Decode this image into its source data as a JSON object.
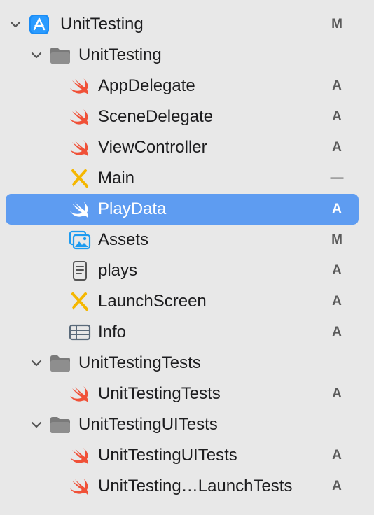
{
  "project": {
    "name": "UnitTesting",
    "status": "M",
    "icon": "app-project-icon",
    "groups": [
      {
        "name": "UnitTesting",
        "icon": "folder-icon",
        "files": [
          {
            "name": "AppDelegate",
            "icon": "swift-file-icon",
            "status": "A"
          },
          {
            "name": "SceneDelegate",
            "icon": "swift-file-icon",
            "status": "A"
          },
          {
            "name": "ViewController",
            "icon": "swift-file-icon",
            "status": "A"
          },
          {
            "name": "Main",
            "icon": "storyboard-icon",
            "status": "—"
          },
          {
            "name": "PlayData",
            "icon": "swift-file-icon",
            "status": "A",
            "selected": true
          },
          {
            "name": "Assets",
            "icon": "asset-catalog-icon",
            "status": "M"
          },
          {
            "name": "plays",
            "icon": "document-icon",
            "status": "A"
          },
          {
            "name": "LaunchScreen",
            "icon": "storyboard-icon",
            "status": "A"
          },
          {
            "name": "Info",
            "icon": "plist-table-icon",
            "status": "A"
          }
        ]
      },
      {
        "name": "UnitTestingTests",
        "icon": "folder-icon",
        "files": [
          {
            "name": "UnitTestingTests",
            "icon": "swift-file-icon",
            "status": "A"
          }
        ]
      },
      {
        "name": "UnitTestingUITests",
        "icon": "folder-icon",
        "files": [
          {
            "name": "UnitTestingUITests",
            "icon": "swift-file-icon",
            "status": "A"
          },
          {
            "name": "UnitTesting…LaunchTests",
            "icon": "swift-file-icon",
            "status": "A"
          }
        ]
      }
    ]
  },
  "colors": {
    "background": "#e8e8e8",
    "selection": "#5e9cf1",
    "swift": "#f05138",
    "folder": "#7a7a7a",
    "storyboard": "#f5b700",
    "assets": "#1d9bf0",
    "status_text": "#5a5a5a"
  }
}
